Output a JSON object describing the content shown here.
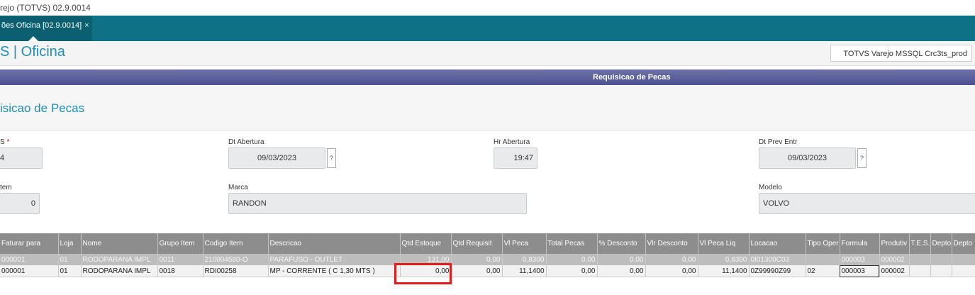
{
  "window": {
    "title": "rejo (TOTVS) 02.9.0014"
  },
  "tabs": [
    {
      "label": "ões Oficina [02.9.0014]",
      "close": "×"
    }
  ],
  "header": {
    "app_name": "S | Oficina",
    "environment": "TOTVS Varejo MSSQL Crc3ts_prod"
  },
  "section": {
    "title": "Requisicao de Pecas"
  },
  "form": {
    "title": "isicao de Pecas",
    "fields": {
      "os": {
        "label": "S",
        "required": "*",
        "value": "4"
      },
      "dt_abertura": {
        "label": "Dt Abertura",
        "value": "09/03/2023",
        "help": "?"
      },
      "hr_abertura": {
        "label": "Hr Abertura",
        "value": "19:47"
      },
      "dt_prev_entr": {
        "label": "Dt Prev Entr",
        "value": "09/03/2023",
        "help": "?"
      },
      "item": {
        "label": "tem",
        "value": "0"
      },
      "marca": {
        "label": "Marca",
        "value": "RANDON"
      },
      "modelo": {
        "label": "Modelo",
        "value": "VOLVO"
      }
    }
  },
  "grid": {
    "columns": [
      "Faturar para",
      "Loja",
      "Nome",
      "Grupo Item",
      "Codigo Item",
      "Descricao",
      "Qtd Estoque",
      "Qtd Requisit",
      "Vl Peca",
      "Total Pecas",
      "% Desconto",
      "Vlr Desconto",
      "Vl Peca Liq",
      "Locacao",
      "Tipo Oper",
      "Formula",
      "Produtiv",
      "T.E.S.",
      "Depto",
      "Depto"
    ],
    "rows": [
      [
        "000001",
        "01",
        "RODOPARANA IMPL",
        "0011",
        "210004580-O",
        "PARAFUSO - OUTLET",
        "131,00",
        "0,00",
        "0,8300",
        "0,00",
        "0,00",
        "0,00",
        "0,8300",
        "0I01300C03",
        "",
        "000003",
        "000002",
        "",
        "",
        ""
      ],
      [
        "000001",
        "01",
        "RODOPARANA IMPL",
        "0018",
        "RDI00258",
        "MP - CORRENTE ( C 1,30 MTS )",
        "0,00",
        "0,00",
        "11,1400",
        "0,00",
        "0,00",
        "0,00",
        "11,1400",
        "0Z99990Z99",
        "02",
        "000003",
        "000002",
        "",
        "",
        ""
      ]
    ]
  },
  "colors": {
    "tabbar": "#0f7185",
    "accent_text": "#1d8fb8",
    "section_bar": "#5a5e9b",
    "highlight": "#e21b1b"
  }
}
